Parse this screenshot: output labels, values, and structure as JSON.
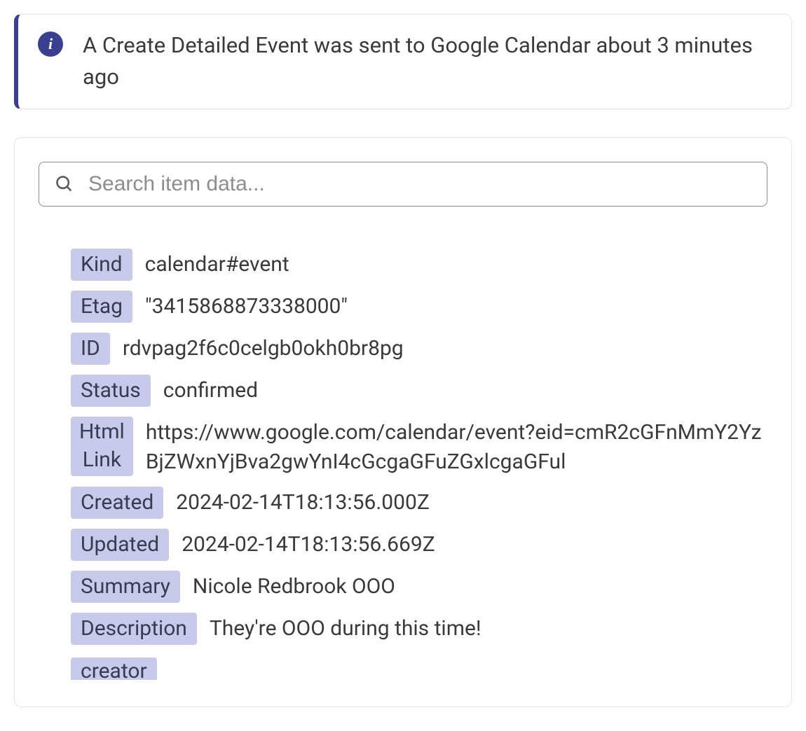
{
  "banner": {
    "message": "A Create Detailed Event was sent to Google Calendar about 3 minutes ago"
  },
  "search": {
    "placeholder": "Search item data..."
  },
  "fields": {
    "kind": {
      "label": "Kind",
      "value": "calendar#event"
    },
    "etag": {
      "label": "Etag",
      "value": "\"3415868873338000\""
    },
    "id": {
      "label": "ID",
      "value": "rdvpag2f6c0celgb0okh0br8pg"
    },
    "status": {
      "label": "Status",
      "value": "confirmed"
    },
    "htmlLink": {
      "label1": "Html",
      "label2": "Link",
      "value": "https://www.google.com/calendar/event?eid=cmR2cGFnMmY2YzBjZWxnYjBva2gwYnI4cGcgaGFuZGxlcgaGFul"
    },
    "created": {
      "label": "Created",
      "value": "2024-02-14T18:13:56.000Z"
    },
    "updated": {
      "label": "Updated",
      "value": "2024-02-14T18:13:56.669Z"
    },
    "summary": {
      "label": "Summary",
      "value": "Nicole Redbrook OOO"
    },
    "description": {
      "label": "Description",
      "value": "They're OOO during this time!"
    },
    "creator": {
      "label": "creator"
    }
  }
}
